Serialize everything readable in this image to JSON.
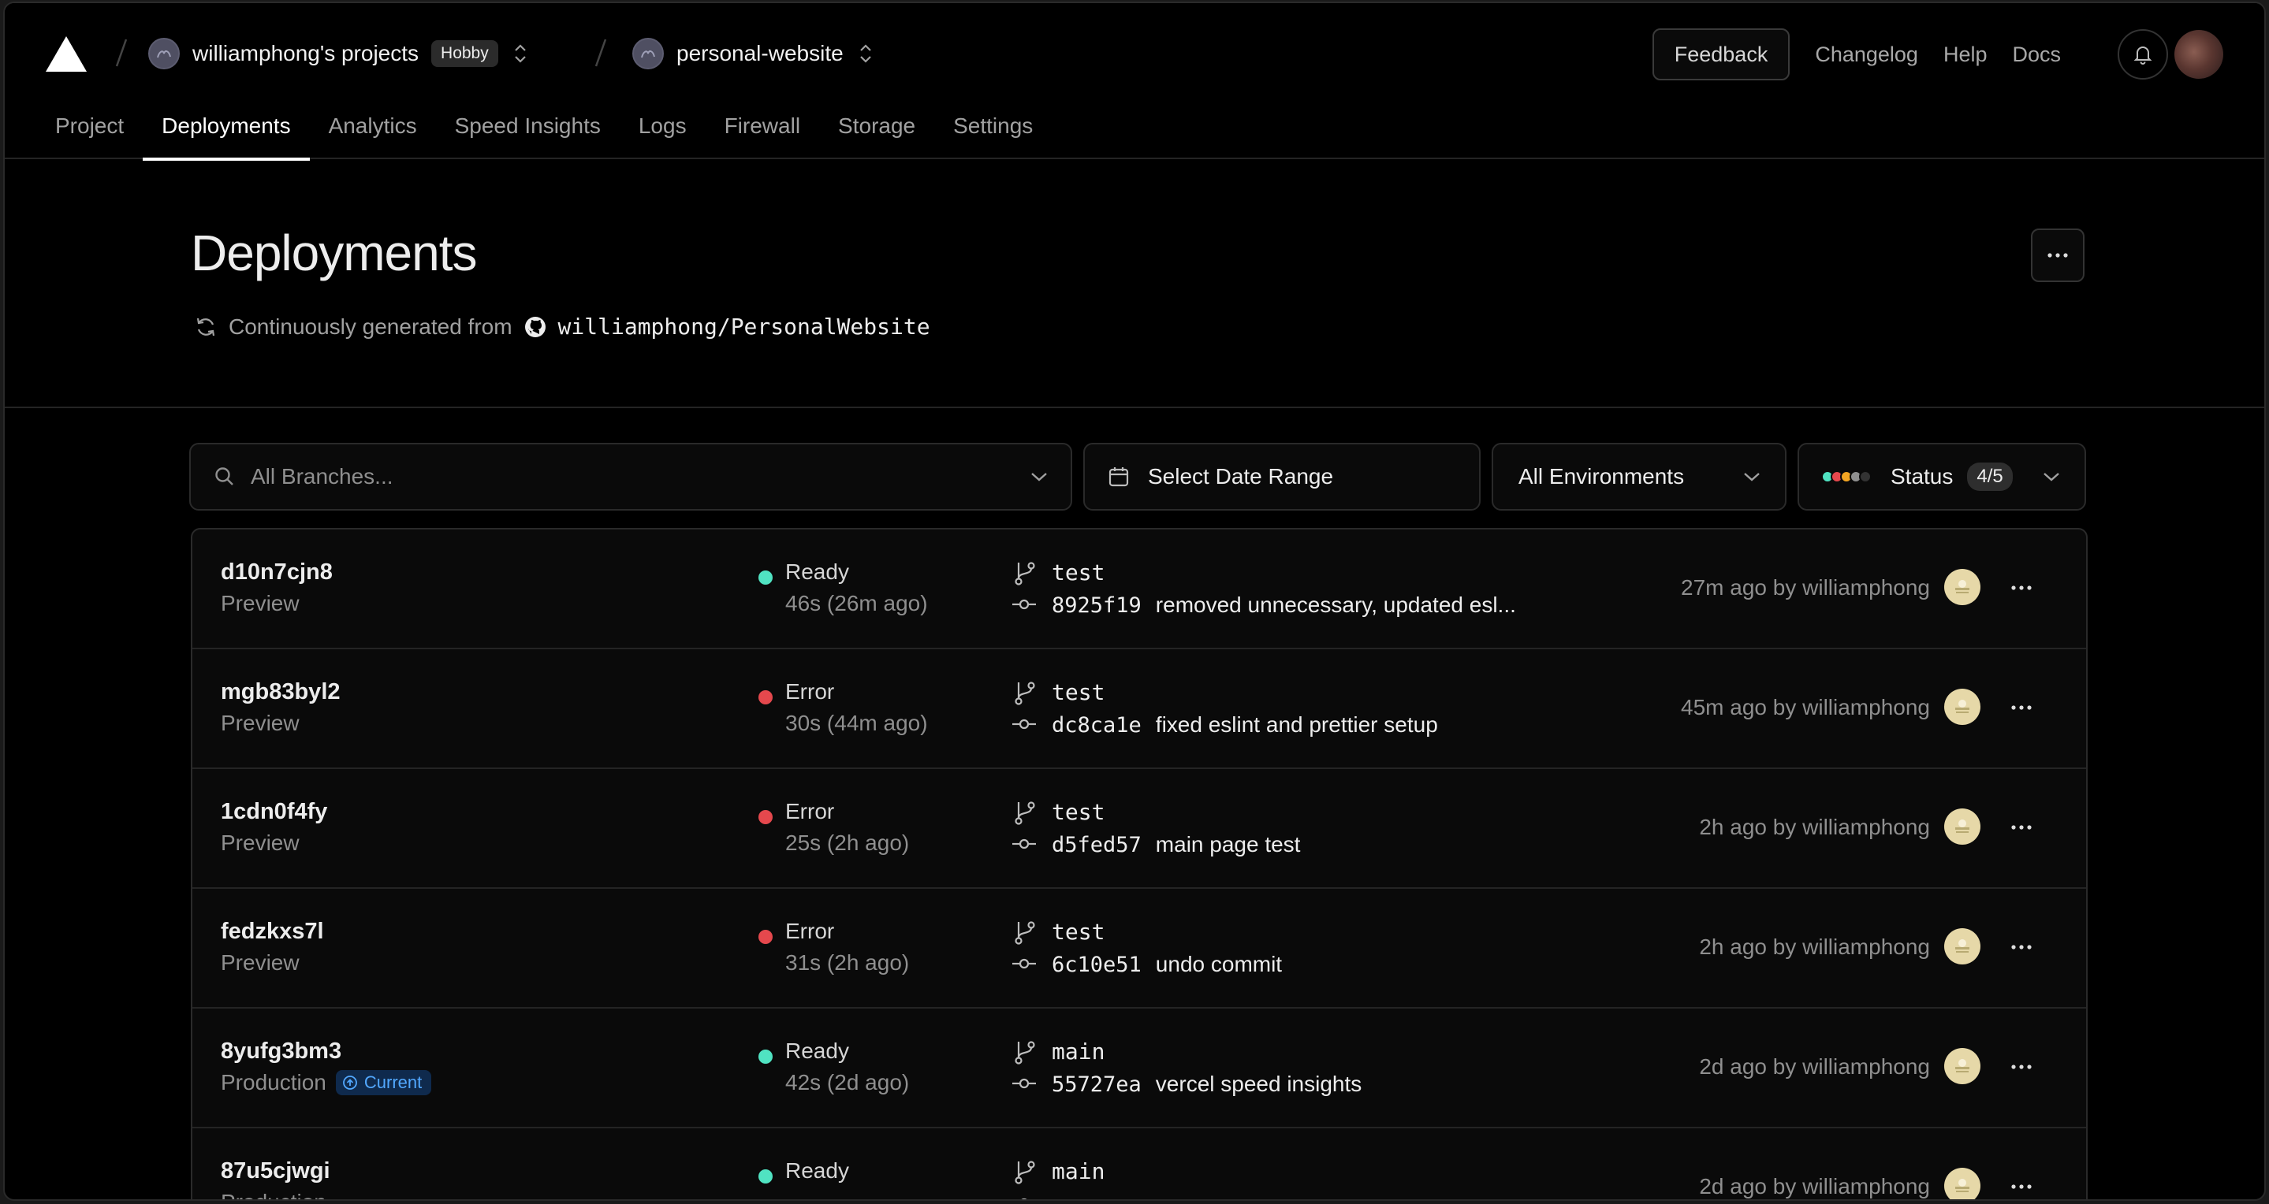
{
  "header": {
    "team_name": "williamphong's projects",
    "plan_badge": "Hobby",
    "project_name": "personal-website",
    "feedback_label": "Feedback",
    "links": [
      "Changelog",
      "Help",
      "Docs"
    ]
  },
  "tabs": [
    {
      "label": "Project",
      "active": false
    },
    {
      "label": "Deployments",
      "active": true
    },
    {
      "label": "Analytics",
      "active": false
    },
    {
      "label": "Speed Insights",
      "active": false
    },
    {
      "label": "Logs",
      "active": false
    },
    {
      "label": "Firewall",
      "active": false
    },
    {
      "label": "Storage",
      "active": false
    },
    {
      "label": "Settings",
      "active": false
    }
  ],
  "page": {
    "title": "Deployments",
    "source_prefix": "Continuously generated from",
    "repo": "williamphong/PersonalWebsite"
  },
  "filters": {
    "branch_placeholder": "All Branches...",
    "date_range": "Select Date Range",
    "environment": "All Environments",
    "status_label": "Status",
    "status_count": "4/5",
    "status_colors": [
      "#50e3c2",
      "#e5484d",
      "#f5a623",
      "#8f8f8f",
      "#333333"
    ]
  },
  "colors": {
    "ready": "#50e3c2",
    "error": "#e5484d",
    "accent": "#52a8ff"
  },
  "deployments": [
    {
      "id": "d10n7cjn8",
      "environment": "Preview",
      "current": "",
      "status": "Ready",
      "status_type": "ready",
      "duration": "46s (26m ago)",
      "branch": "test",
      "commit_hash": "8925f19",
      "commit_message": "removed unnecessary, updated esl...",
      "created": "27m ago by williamphong"
    },
    {
      "id": "mgb83byl2",
      "environment": "Preview",
      "current": "",
      "status": "Error",
      "status_type": "error",
      "duration": "30s (44m ago)",
      "branch": "test",
      "commit_hash": "dc8ca1e",
      "commit_message": "fixed eslint and prettier setup",
      "created": "45m ago by williamphong"
    },
    {
      "id": "1cdn0f4fy",
      "environment": "Preview",
      "current": "",
      "status": "Error",
      "status_type": "error",
      "duration": "25s (2h ago)",
      "branch": "test",
      "commit_hash": "d5fed57",
      "commit_message": "main page test",
      "created": "2h ago by williamphong"
    },
    {
      "id": "fedzkxs7l",
      "environment": "Preview",
      "current": "",
      "status": "Error",
      "status_type": "error",
      "duration": "31s (2h ago)",
      "branch": "test",
      "commit_hash": "6c10e51",
      "commit_message": "undo commit",
      "created": "2h ago by williamphong"
    },
    {
      "id": "8yufg3bm3",
      "environment": "Production",
      "current": "Current",
      "status": "Ready",
      "status_type": "ready",
      "duration": "42s (2d ago)",
      "branch": "main",
      "commit_hash": "55727ea",
      "commit_message": "vercel speed insights",
      "created": "2d ago by williamphong"
    },
    {
      "id": "87u5cjwgi",
      "environment": "Production",
      "current": "",
      "status": "Ready",
      "status_type": "ready",
      "duration": "",
      "branch": "main",
      "commit_hash": "",
      "commit_message": "",
      "created": "2d ago by williamphong"
    }
  ]
}
